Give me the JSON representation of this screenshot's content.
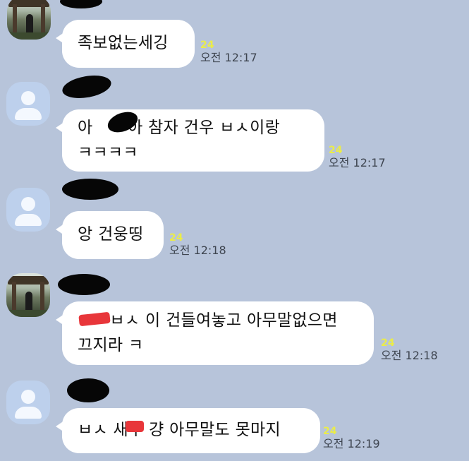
{
  "messages": [
    {
      "lines": [
        "족보없는세깅"
      ],
      "unread": "24",
      "time": "오전 12:17"
    },
    {
      "lines": [
        "아 ",
        "아 참자 건우 ㅂㅅ이랑",
        "ㅋㅋㅋㅋ"
      ],
      "unread": "24",
      "time": "오전 12:17"
    },
    {
      "lines": [
        "앙 건웅띵"
      ],
      "unread": "24",
      "time": "오전 12:18"
    },
    {
      "lines": [
        "ㅅ",
        "ㅂㅅ 이 건들여놓고 아무말없으면",
        "끄지라 ㅋ"
      ],
      "unread": "24",
      "time": "오전 12:18"
    },
    {
      "lines": [
        "ㅂㅅ 새",
        "ㅣ 걍 아무말도 못마지"
      ],
      "unread": "24",
      "time": "오전 12:19"
    }
  ],
  "icons": {
    "profile_default": "default-profile-icon",
    "profile_photo": "profile-photo"
  },
  "colors": {
    "background": "#b7c4da",
    "bubble": "#ffffff",
    "unread": "#eaec4a",
    "time": "#3e4550"
  }
}
